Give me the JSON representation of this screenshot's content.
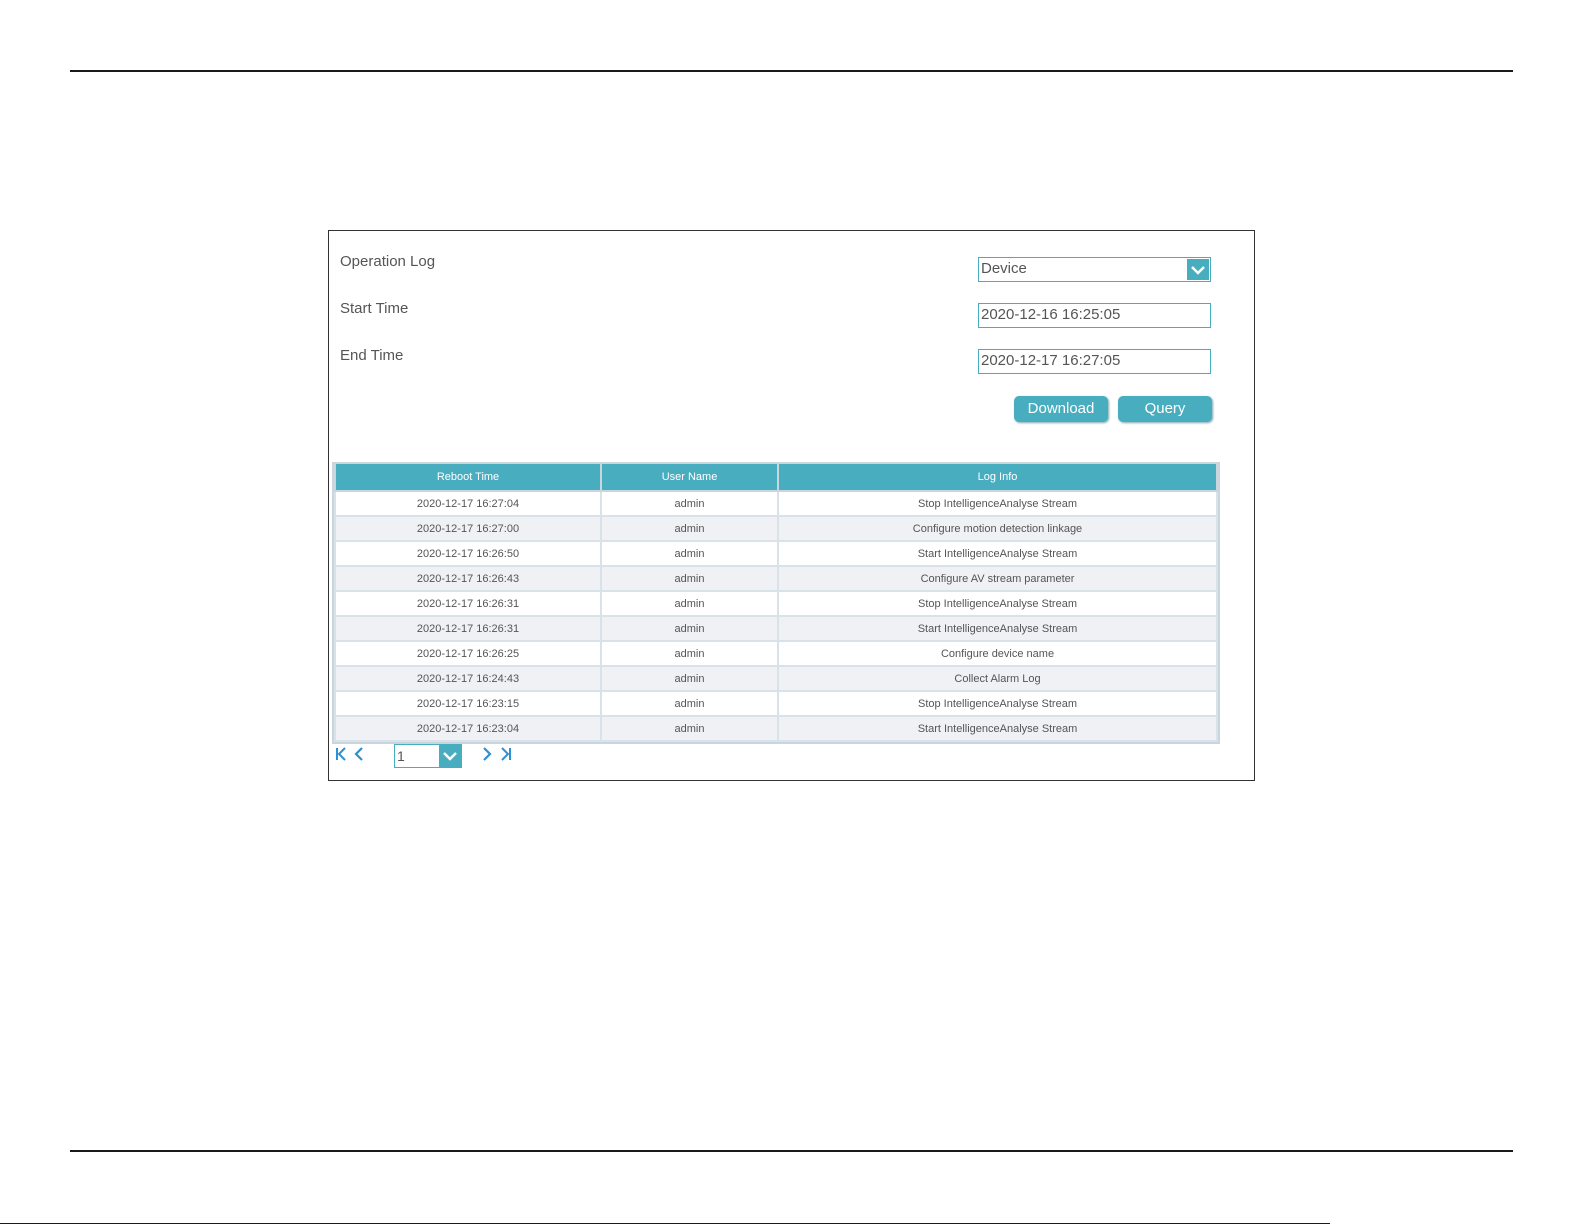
{
  "form": {
    "operation_log_label": "Operation Log",
    "operation_log_value": "Device",
    "start_time_label": "Start Time",
    "start_time_value": "2020-12-16 16:25:05",
    "end_time_label": "End Time",
    "end_time_value": "2020-12-17 16:27:05",
    "download_label": "Download",
    "query_label": "Query"
  },
  "table": {
    "headers": [
      "Reboot Time",
      "User Name",
      "Log Info"
    ],
    "rows": [
      [
        "2020-12-17 16:27:04",
        "admin",
        "Stop IntelligenceAnalyse Stream"
      ],
      [
        "2020-12-17 16:27:00",
        "admin",
        "Configure motion detection linkage"
      ],
      [
        "2020-12-17 16:26:50",
        "admin",
        "Start IntelligenceAnalyse Stream"
      ],
      [
        "2020-12-17 16:26:43",
        "admin",
        "Configure AV stream parameter"
      ],
      [
        "2020-12-17 16:26:31",
        "admin",
        "Stop IntelligenceAnalyse Stream"
      ],
      [
        "2020-12-17 16:26:31",
        "admin",
        "Start IntelligenceAnalyse Stream"
      ],
      [
        "2020-12-17 16:26:25",
        "admin",
        "Configure device name"
      ],
      [
        "2020-12-17 16:24:43",
        "admin",
        "Collect Alarm Log"
      ],
      [
        "2020-12-17 16:23:15",
        "admin",
        "Stop IntelligenceAnalyse Stream"
      ],
      [
        "2020-12-17 16:23:04",
        "admin",
        "Start IntelligenceAnalyse Stream"
      ]
    ]
  },
  "pager": {
    "current_page": "1",
    "icons": [
      "first-page-icon",
      "prev-page-icon",
      "chevron-down-icon",
      "next-page-icon",
      "last-page-icon"
    ]
  },
  "colors": {
    "accent": "#49adc0",
    "row_alt": "#eff1f4",
    "border": "#c9d6de"
  }
}
